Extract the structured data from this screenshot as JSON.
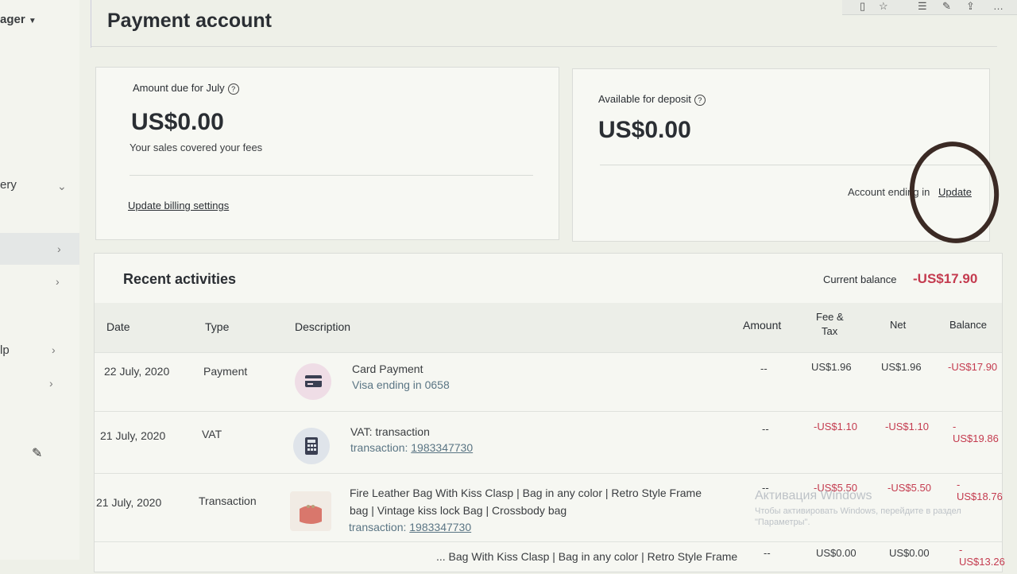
{
  "sidebar": {
    "account_menu": "ager",
    "item_ery": "ery",
    "item_lp": "lp"
  },
  "page": {
    "title": "Payment account"
  },
  "amount_due": {
    "title": "Amount due for July",
    "value": "US$0.00",
    "note": "Your sales covered your fees",
    "link": "Update billing settings"
  },
  "deposit": {
    "title": "Available for deposit",
    "value": "US$0.00",
    "account_label": "Account ending in",
    "update_link": "Update"
  },
  "activities": {
    "title": "Recent activities",
    "balance_label": "Current balance",
    "balance_value": "-US$17.90",
    "headers": {
      "date": "Date",
      "type": "Type",
      "description": "Description",
      "amount": "Amount",
      "fee_tax_1": "Fee &",
      "fee_tax_2": "Tax",
      "net": "Net",
      "balance": "Balance"
    },
    "rows": [
      {
        "date": "22 July, 2020",
        "type": "Payment",
        "title": "Card Payment",
        "sub": "Visa ending in 0658",
        "amount": "--",
        "fee": "US$1.96",
        "net": "US$1.96",
        "balance": "-US$17.90",
        "icon": "credit-card-icon"
      },
      {
        "date": "21 July, 2020",
        "type": "VAT",
        "title": "VAT: transaction",
        "tx_prefix": "transaction: ",
        "tx_link": "1983347730",
        "amount": "--",
        "fee": "-US$1.10",
        "net": "-US$1.10",
        "balance": "-US$19.86",
        "icon": "calculator-icon"
      },
      {
        "date": "21 July, 2020",
        "type": "Transaction",
        "title_1": "Fire Leather Bag With Kiss Clasp | Bag in any color | Retro Style Frame",
        "title_2": "bag | Vintage kiss lock Bag | Crossbody bag",
        "tx_prefix": "transaction: ",
        "tx_link": "1983347730",
        "amount": "--",
        "fee": "-US$5.50",
        "net": "-US$5.50",
        "balance": "-US$18.76",
        "icon": "bag-thumbnail"
      },
      {
        "title_1": "... Bag With Kiss Clasp | Bag in any color | Retro Style Frame",
        "amount": "--",
        "fee": "US$0.00",
        "net": "US$0.00",
        "balance": "-US$13.26"
      }
    ]
  },
  "watermark": {
    "line1": "Активация Windows",
    "line2": "Чтобы активировать Windows, перейдите в раздел",
    "line3": "\"Параметры\"."
  },
  "colors": {
    "negative": "#c43b4f",
    "background": "#eef0e8"
  }
}
